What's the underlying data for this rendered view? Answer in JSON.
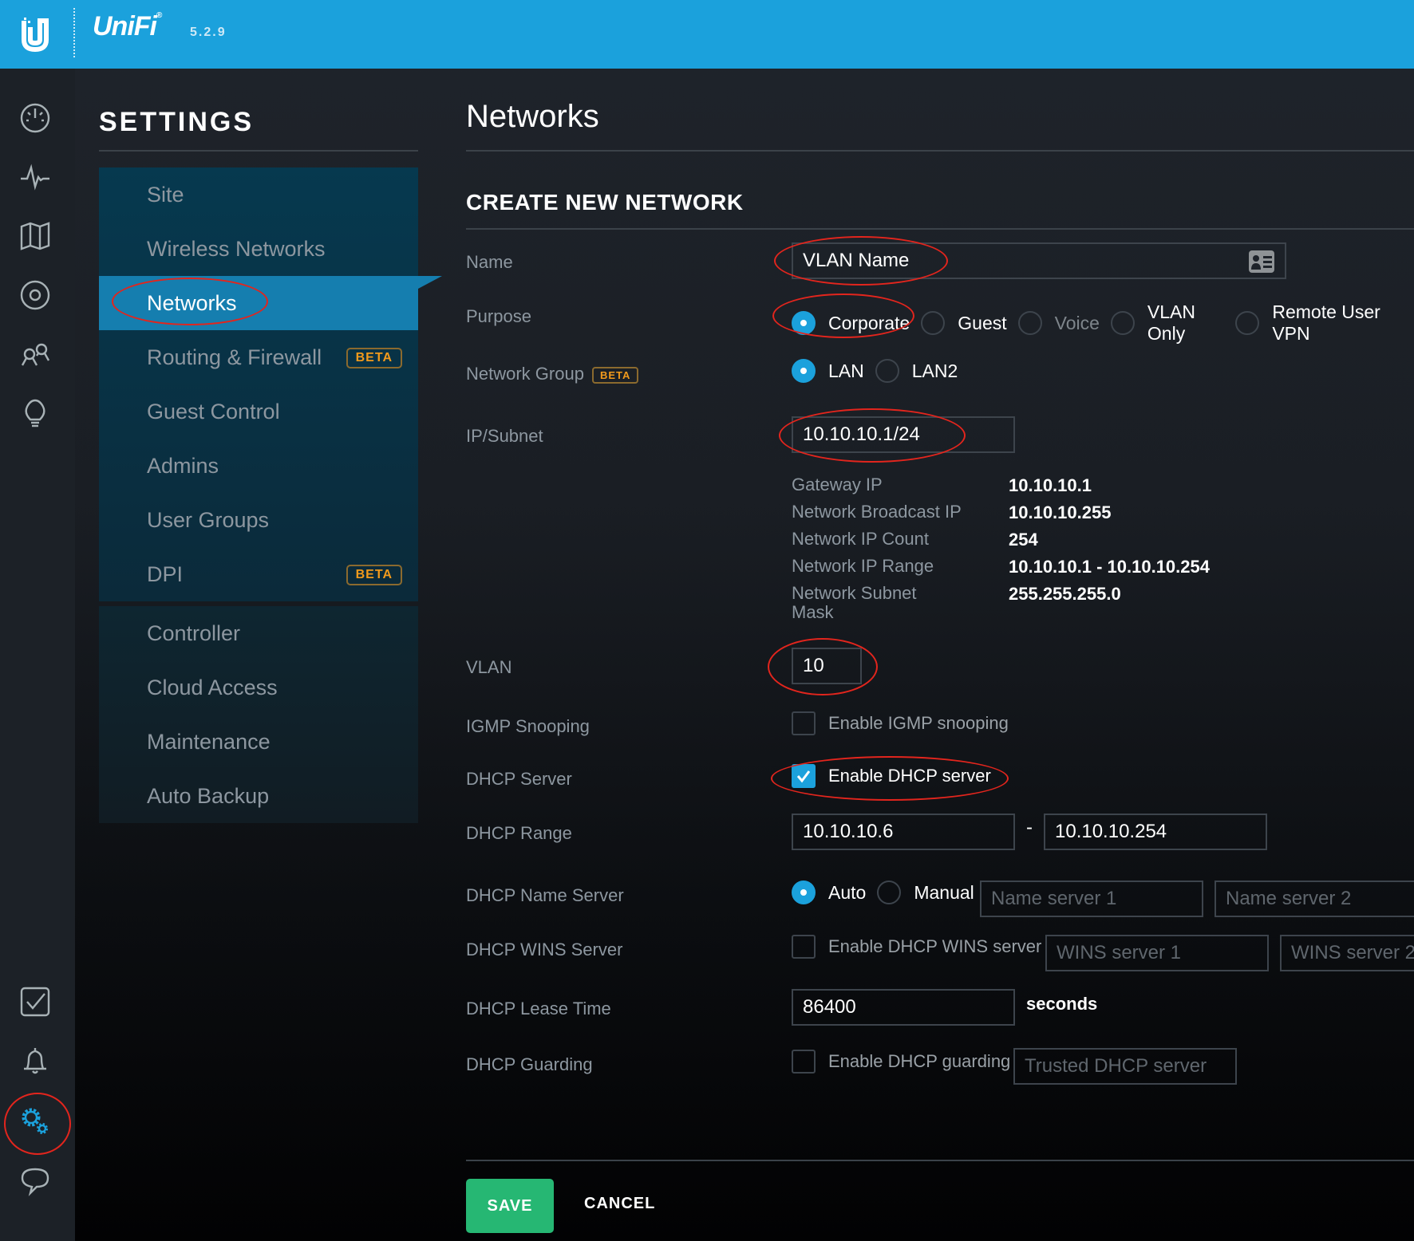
{
  "header": {
    "logo": "ubiquiti-u-logo",
    "brand": "UniFi",
    "registered_mark": "®",
    "version": "5.2.9"
  },
  "rail": {
    "icons": [
      "dashboard-icon",
      "statistics-icon",
      "map-icon",
      "devices-icon",
      "clients-icon",
      "insights-icon",
      "events-icon",
      "alerts-icon",
      "settings-icon",
      "chat-icon"
    ],
    "active": "settings-icon"
  },
  "sidebar": {
    "title": "SETTINGS",
    "groups": [
      [
        {
          "label": "Site"
        },
        {
          "label": "Wireless Networks"
        },
        {
          "label": "Networks",
          "active": true
        },
        {
          "label": "Routing & Firewall",
          "badge": "BETA"
        },
        {
          "label": "Guest Control"
        },
        {
          "label": "Admins"
        },
        {
          "label": "User Groups"
        },
        {
          "label": "DPI",
          "badge": "BETA"
        }
      ],
      [
        {
          "label": "Controller"
        },
        {
          "label": "Cloud Access"
        },
        {
          "label": "Maintenance"
        },
        {
          "label": "Auto Backup"
        }
      ]
    ]
  },
  "main": {
    "page_title": "Networks",
    "section_title": "CREATE NEW NETWORK",
    "form": {
      "name": {
        "label": "Name",
        "value": "VLAN Name"
      },
      "purpose": {
        "label": "Purpose",
        "options": [
          "Corporate",
          "Guest",
          "Voice",
          "VLAN Only",
          "Remote User VPN"
        ],
        "selected": "Corporate",
        "disabled": [
          "Voice"
        ]
      },
      "network_group": {
        "label": "Network Group",
        "badge": "BETA",
        "options": [
          "LAN",
          "LAN2"
        ],
        "selected": "LAN"
      },
      "ip_subnet": {
        "label": "IP/Subnet",
        "value": "10.10.10.1/24"
      },
      "subnet_info": [
        {
          "key": "Gateway IP",
          "value": "10.10.10.1"
        },
        {
          "key": "Network Broadcast IP",
          "value": "10.10.10.255"
        },
        {
          "key": "Network IP Count",
          "value": "254"
        },
        {
          "key": "Network IP Range",
          "value": "10.10.10.1 - 10.10.10.254"
        },
        {
          "key": "Network Subnet Mask",
          "value": "255.255.255.0"
        }
      ],
      "vlan": {
        "label": "VLAN",
        "value": "10"
      },
      "igmp": {
        "label": "IGMP Snooping",
        "checkbox_label": "Enable IGMP snooping",
        "checked": false
      },
      "dhcp_server": {
        "label": "DHCP Server",
        "checkbox_label": "Enable DHCP server",
        "checked": true
      },
      "dhcp_range": {
        "label": "DHCP Range",
        "start": "10.10.10.6",
        "separator": "-",
        "end": "10.10.10.254"
      },
      "dhcp_name_server": {
        "label": "DHCP Name Server",
        "options": [
          "Auto",
          "Manual"
        ],
        "selected": "Auto",
        "placeholder_1": "Name server 1",
        "placeholder_2": "Name server 2"
      },
      "dhcp_wins": {
        "label": "DHCP WINS Server",
        "checkbox_label": "Enable DHCP WINS server",
        "checked": false,
        "placeholder_1": "WINS server 1",
        "placeholder_2": "WINS server 2"
      },
      "dhcp_lease": {
        "label": "DHCP Lease Time",
        "value": "86400",
        "unit": "seconds"
      },
      "dhcp_guarding": {
        "label": "DHCP Guarding",
        "checkbox_label": "Enable DHCP guarding",
        "checked": false,
        "placeholder": "Trusted DHCP server"
      }
    },
    "buttons": {
      "save": "SAVE",
      "cancel": "CANCEL"
    }
  },
  "colors": {
    "brand_blue": "#1ba1dc",
    "active_nav": "#157eaf",
    "save_green": "#26b773",
    "beta_orange": "#f19a1c",
    "annotation_red": "#e3251d"
  }
}
